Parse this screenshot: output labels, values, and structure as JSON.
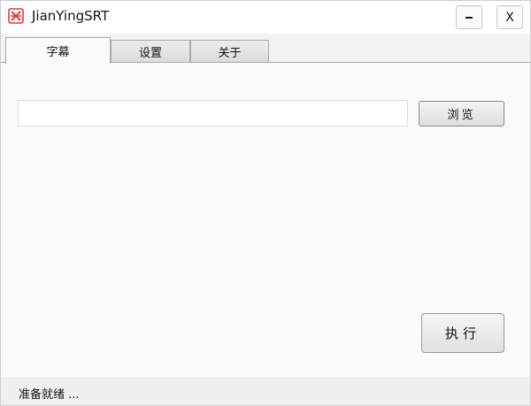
{
  "window": {
    "title": "JianYingSRT",
    "icon": "jianying-app-icon",
    "icon_color": "#e2383f",
    "minimize_label": "−",
    "close_label": "X"
  },
  "tabs": [
    {
      "label": "字幕",
      "active": true
    },
    {
      "label": "设置",
      "active": false
    },
    {
      "label": "关于",
      "active": false
    }
  ],
  "main": {
    "path_value": "",
    "browse_label": "浏览",
    "run_label": "执行"
  },
  "status": {
    "text": "准备就绪 ..."
  }
}
